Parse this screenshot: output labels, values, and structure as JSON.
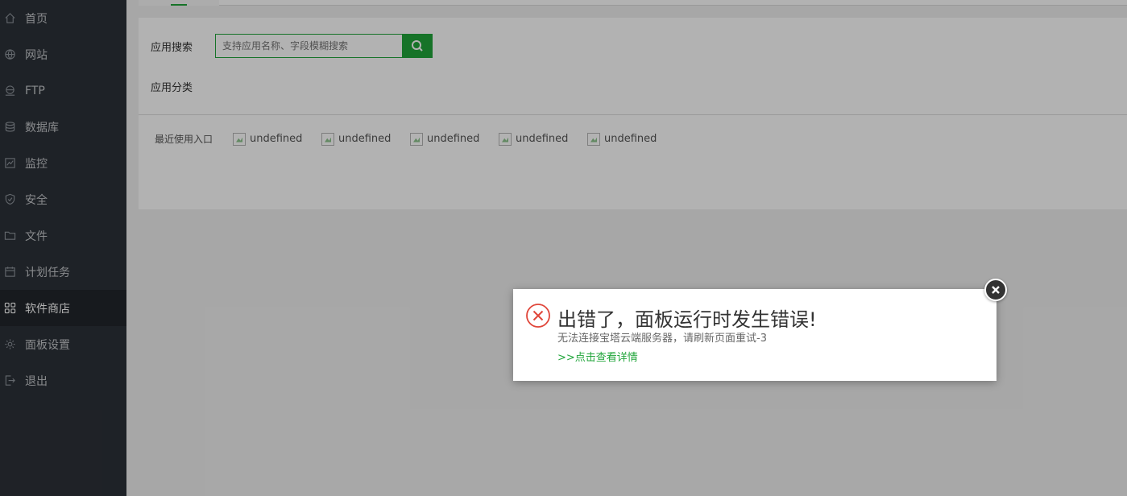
{
  "sidebar": {
    "items": [
      {
        "label": "首页",
        "icon": "home-icon"
      },
      {
        "label": "网站",
        "icon": "globe-icon"
      },
      {
        "label": "FTP",
        "icon": "ftp-icon"
      },
      {
        "label": "数据库",
        "icon": "database-icon"
      },
      {
        "label": "监控",
        "icon": "monitor-icon"
      },
      {
        "label": "安全",
        "icon": "shield-icon"
      },
      {
        "label": "文件",
        "icon": "folder-icon"
      },
      {
        "label": "计划任务",
        "icon": "calendar-icon"
      },
      {
        "label": "软件商店",
        "icon": "grid-icon",
        "active": true
      },
      {
        "label": "面板设置",
        "icon": "gear-icon"
      },
      {
        "label": "退出",
        "icon": "logout-icon"
      }
    ]
  },
  "main": {
    "search": {
      "label": "应用搜索",
      "placeholder": "支持应用名称、字段模糊搜索"
    },
    "category": {
      "label": "应用分类"
    },
    "recent": {
      "label": "最近使用入口",
      "items": [
        "undefined",
        "undefined",
        "undefined",
        "undefined",
        "undefined"
      ]
    }
  },
  "dialog": {
    "title": "出错了，面板运行时发生错误!",
    "message": "无法连接宝塔云端服务器，请刷新页面重试-3",
    "link": ">>点击查看详情"
  },
  "colors": {
    "accent": "#20a53a",
    "error": "#e0463a",
    "sidebar": "#2c3138"
  }
}
